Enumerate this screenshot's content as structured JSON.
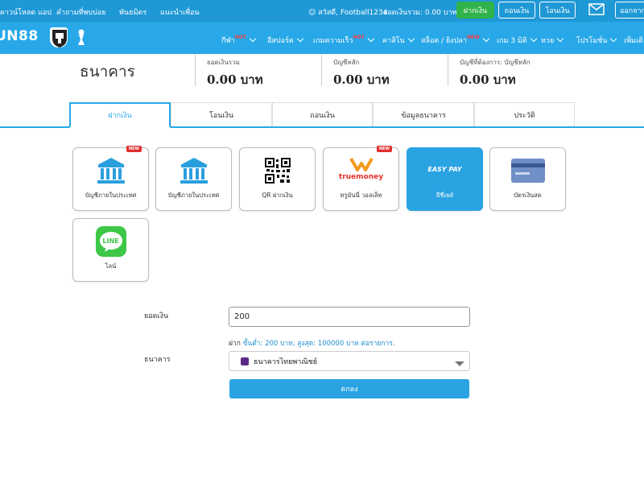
{
  "topbar": {
    "download_app": "ดาวน์โหลด แอป",
    "faq": "คำถามที่พบบ่อย",
    "partners": "พันธมิตร",
    "refer_friend": "แนะนำเพื่อน",
    "greeting": "สวัสดี, Football1234",
    "balance_text": "ยอดเงินรวม: 0.00 บาท",
    "deposit_btn": "ฝากเงิน",
    "withdraw_btn": "ถอนเงิน",
    "transfer_btn": "โอนเงิน",
    "logout_btn": "ออกจาก"
  },
  "brand": {
    "logo_text": "UN88"
  },
  "nav": {
    "items": [
      {
        "label": "กีฬา",
        "hot": "HOT"
      },
      {
        "label": "อีสปอร์ต",
        "hot": ""
      },
      {
        "label": "เกมความเร็ว",
        "hot": "HOT"
      },
      {
        "label": "คาสิโน",
        "hot": ""
      },
      {
        "label": "สล็อต / ยิงปลา",
        "hot": "NEW"
      },
      {
        "label": "เกม 3 มิติ",
        "hot": ""
      },
      {
        "label": "หวย",
        "hot": ""
      },
      {
        "label": "โปรโมชั่น",
        "hot": ""
      },
      {
        "label": "เพิ่มเติ",
        "hot": ""
      }
    ]
  },
  "page": {
    "title": "ธนาคาร",
    "stats": [
      {
        "label": "ยอดเงินรวม",
        "value": "0.00 บาท"
      },
      {
        "label": "บัญชีหลัก",
        "value": "0.00 บาท"
      },
      {
        "label": "บัญชีที่ต้องการ: บัญชีหลัก",
        "value": "0.00 บาท"
      }
    ]
  },
  "tabs": [
    {
      "label": "ฝากเงิน",
      "active": true
    },
    {
      "label": "โอนเงิน",
      "active": false
    },
    {
      "label": "ถอนเงิน",
      "active": false
    },
    {
      "label": "ข้อมูลธนาคาร",
      "active": false
    },
    {
      "label": "ประวัติ",
      "active": false
    }
  ],
  "methods": [
    {
      "label": "บัญชีภายในประเทศ",
      "icon": "bank-icon",
      "badge": "NEW",
      "active": false
    },
    {
      "label": "บัญชีภายในประเทศ",
      "icon": "bank-icon",
      "badge": "",
      "active": false
    },
    {
      "label": "QR ฝากเงิน",
      "icon": "qr-code-icon",
      "badge": "",
      "active": false
    },
    {
      "label": "ทรูมันนี่ วอลเล็ท",
      "icon": "truemoney-icon",
      "badge": "NEW",
      "active": false,
      "brand_text": "truemoney"
    },
    {
      "label": "อีซี่เพย์",
      "icon": "easypay-icon",
      "badge": "",
      "active": true,
      "brand_text": "EASY PAY"
    },
    {
      "label": "บัตรเงินสด",
      "icon": "card-icon",
      "badge": "",
      "active": false
    },
    {
      "label": "ไลน์",
      "icon": "line-icon",
      "badge": "",
      "active": false,
      "brand_text": "LINE"
    }
  ],
  "form": {
    "amount_label": "ยอดเงิน",
    "amount_value": "200",
    "hint_prefix": "ฝาก",
    "hint_body": "ขั้นต่ำ: 200 บาท, สูงสุด: 100000 บาท ต่อรายการ.",
    "bank_label": "ธนาคาร",
    "bank_value": "ธนาคารไทยพาณิชย์",
    "submit_label": "ตกลง"
  },
  "colors": {
    "topbar": "#1f98d6",
    "navbar": "#28a8e8",
    "accent": "#2aa3e3",
    "green": "#2fb34a",
    "hot": "#ff3b3b"
  }
}
